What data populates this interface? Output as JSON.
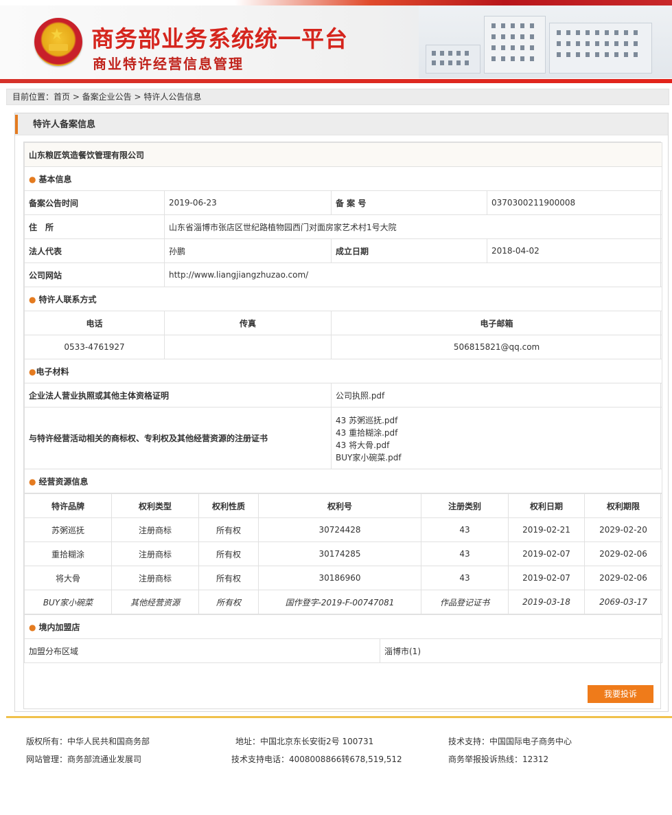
{
  "header": {
    "title": "商务部业务系统统一平台",
    "subtitle": "商业特许经营信息管理"
  },
  "breadcrumb": {
    "text": "目前位置：首页 > 备案企业公告 > 特许人公告信息"
  },
  "panel": {
    "title": "特许人备案信息"
  },
  "company": {
    "name": "山东粮匠筑造餐饮管理有限公司"
  },
  "basic": {
    "section": "基本信息",
    "record_date_label": "备案公告时间",
    "record_date": "2019-06-23",
    "record_no_label": "备 案 号",
    "record_no": "0370300211900008",
    "address_label": "住　所",
    "address": "山东省淄博市张店区世纪路植物园西门对面房家艺术村1号大院",
    "legal_rep_label": "法人代表",
    "legal_rep": "孙鹏",
    "founded_label": "成立日期",
    "founded": "2018-04-02",
    "website_label": "公司网站",
    "website": "http://www.liangjiangzhuzao.com/"
  },
  "contact": {
    "section": "特许人联系方式",
    "phone_label": "电话",
    "fax_label": "传真",
    "email_label": "电子邮箱",
    "phone": "0533-4761927",
    "fax": "",
    "email": "506815821@qq.com"
  },
  "materials": {
    "section": "电子材料",
    "license_label": "企业法人营业执照或其他主体资格证明",
    "license_file": "公司执照.pdf",
    "cert_label": "与特许经营活动相关的商标权、专利权及其他经营资源的注册证书",
    "cert_files": [
      "43 苏粥巡抚.pdf",
      "43 重拾糊涂.pdf",
      "43 将大骨.pdf",
      "BUY家小碗菜.pdf"
    ]
  },
  "resources": {
    "section": "经营资源信息",
    "headers": [
      "特许品牌",
      "权利类型",
      "权利性质",
      "权利号",
      "注册类别",
      "权利日期",
      "权利期限"
    ],
    "rows": [
      [
        "苏粥巡抚",
        "注册商标",
        "所有权",
        "30724428",
        "43",
        "2019-02-21",
        "2029-02-20"
      ],
      [
        "重拾糊涂",
        "注册商标",
        "所有权",
        "30174285",
        "43",
        "2019-02-07",
        "2029-02-06"
      ],
      [
        "将大骨",
        "注册商标",
        "所有权",
        "30186960",
        "43",
        "2019-02-07",
        "2029-02-06"
      ],
      [
        "BUY家小碗菜",
        "其他经营资源",
        "所有权",
        "国作登字-2019-F-00747081",
        "作品登记证书",
        "2019-03-18",
        "2069-03-17"
      ]
    ]
  },
  "stores": {
    "section": "境内加盟店",
    "region_label": "加盟分布区域",
    "region_value": "淄博市(1)"
  },
  "actions": {
    "complain": "我要投诉"
  },
  "footer": {
    "copyright": "版权所有：中华人民共和国商务部",
    "address": "地址：中国北京东长安街2号 100731",
    "tech_support": "技术支持：中国国际电子商务中心",
    "site_admin": "网站管理：商务部流通业发展司",
    "tech_phone": "技术支持电话：4008008866转678,519,512",
    "hotline": "商务举报投诉热线：12312"
  },
  "colors": {
    "brand_red": "#d5251d",
    "accent_orange": "#e47b20",
    "button_orange": "#ef7b1a"
  }
}
